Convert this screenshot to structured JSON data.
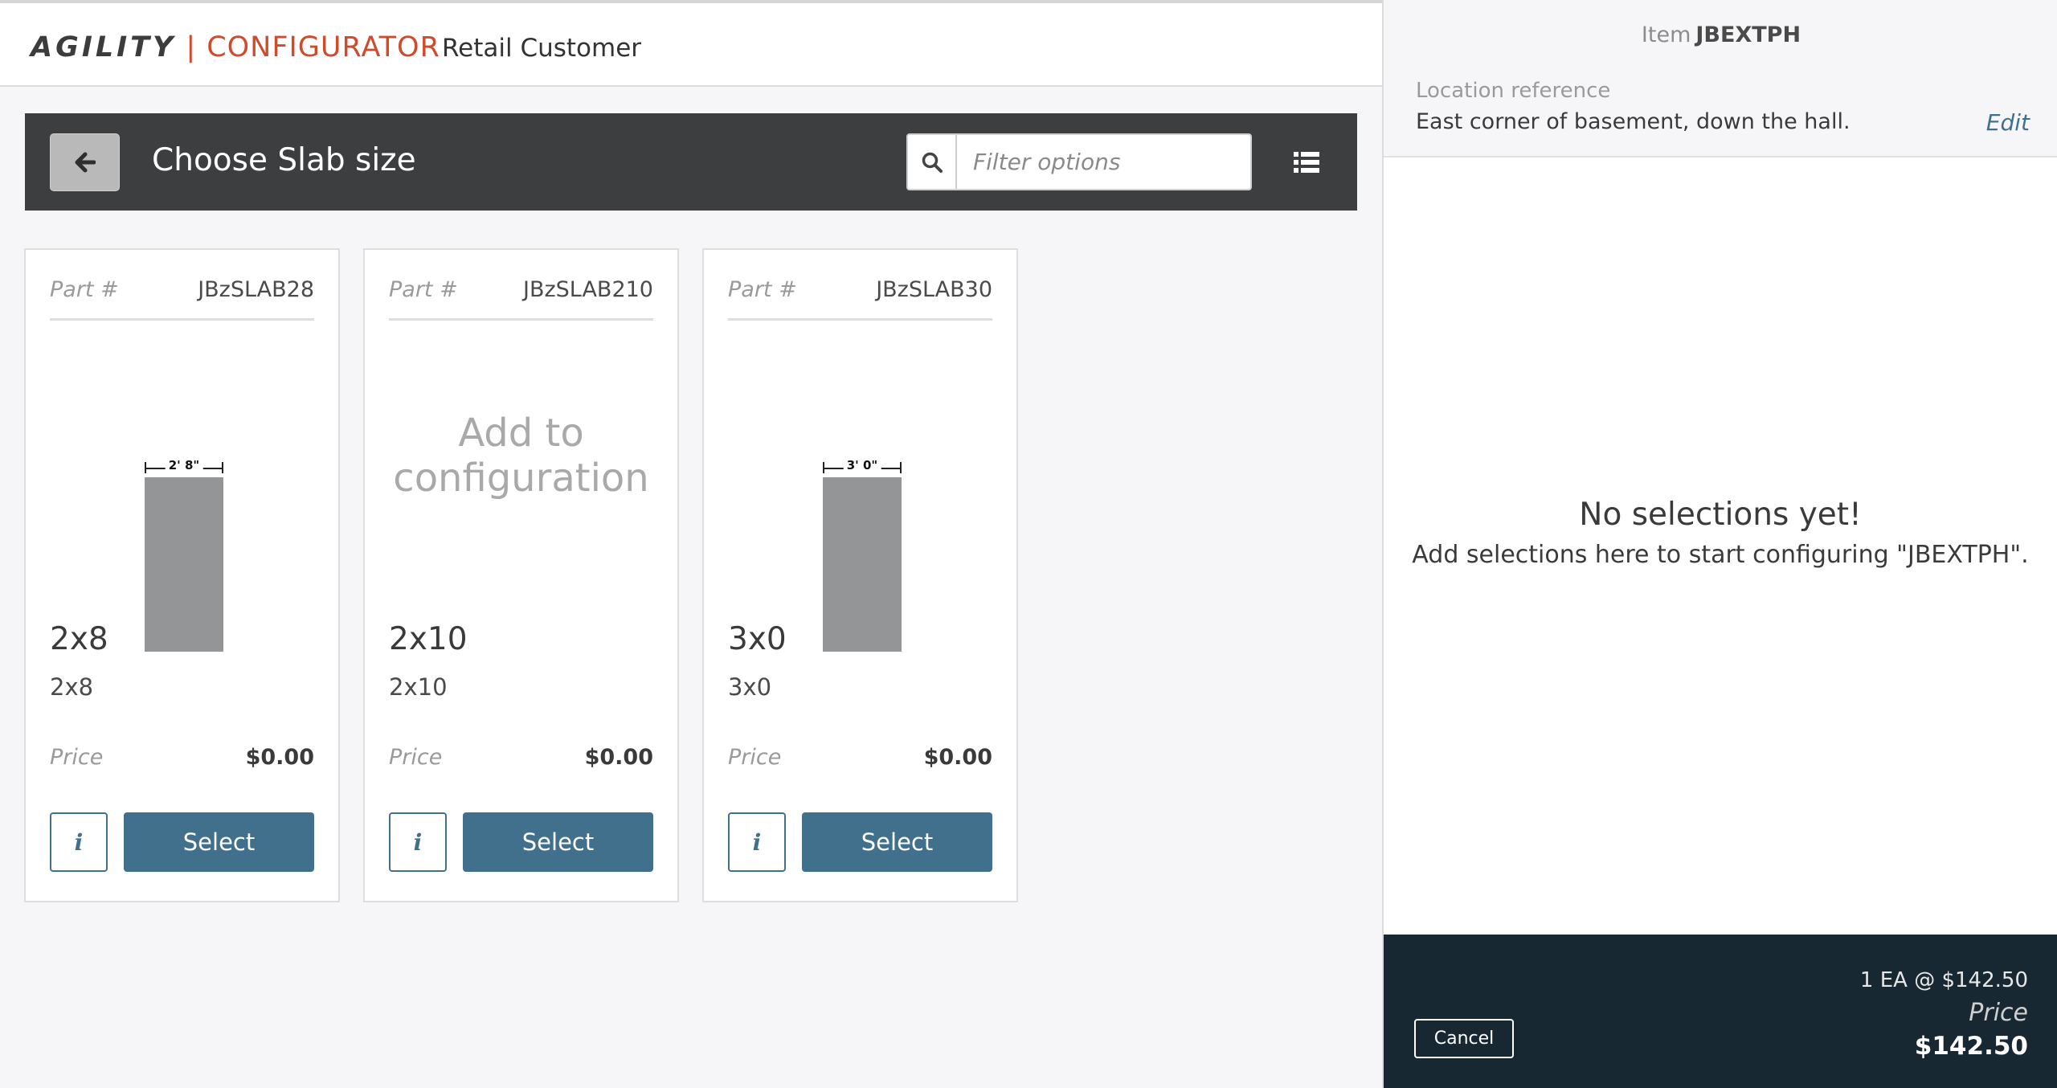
{
  "brand": {
    "part1": "AGILITY",
    "separator": "|",
    "part2": "CONFIGURATOR"
  },
  "customer": "Retail Customer",
  "header": {
    "title": "Choose Slab size",
    "filter_placeholder": "Filter options"
  },
  "cards": [
    {
      "part_label": "Part #",
      "part_number": "JBzSLAB28",
      "has_image": true,
      "dimension_label": "2' 8\"",
      "name": "2x8",
      "description": "2x8",
      "price_label": "Price",
      "price": "$0.00",
      "info_label": "i",
      "select_label": "Select"
    },
    {
      "part_label": "Part #",
      "part_number": "JBzSLAB210",
      "has_image": false,
      "placeholder": "Add to configuration",
      "name": "2x10",
      "description": "2x10",
      "price_label": "Price",
      "price": "$0.00",
      "info_label": "i",
      "select_label": "Select"
    },
    {
      "part_label": "Part #",
      "part_number": "JBzSLAB30",
      "has_image": true,
      "dimension_label": "3' 0\"",
      "name": "3x0",
      "description": "3x0",
      "price_label": "Price",
      "price": "$0.00",
      "info_label": "i",
      "select_label": "Select"
    }
  ],
  "panel": {
    "item_prefix": "Item",
    "item_code": "JBEXTPH",
    "location_label": "Location reference",
    "location_value": "East corner of basement, down the hall.",
    "edit_label": "Edit",
    "empty_title": "No selections yet!",
    "empty_subtitle": "Add selections here to start configuring \"JBEXTPH\"."
  },
  "footer": {
    "quantity_line": "1 EA @ $142.50",
    "price_label": "Price",
    "price": "$142.50",
    "cancel_label": "Cancel"
  },
  "colors": {
    "brand_accent": "#d04a2c",
    "header_bg": "#3d3e40",
    "button_primary": "#41708d",
    "footer_bg": "#182832",
    "slab_gray": "#949597"
  },
  "icons": {
    "back": "arrow-left-icon",
    "search": "search-icon",
    "list": "list-view-icon",
    "info": "info-icon"
  }
}
